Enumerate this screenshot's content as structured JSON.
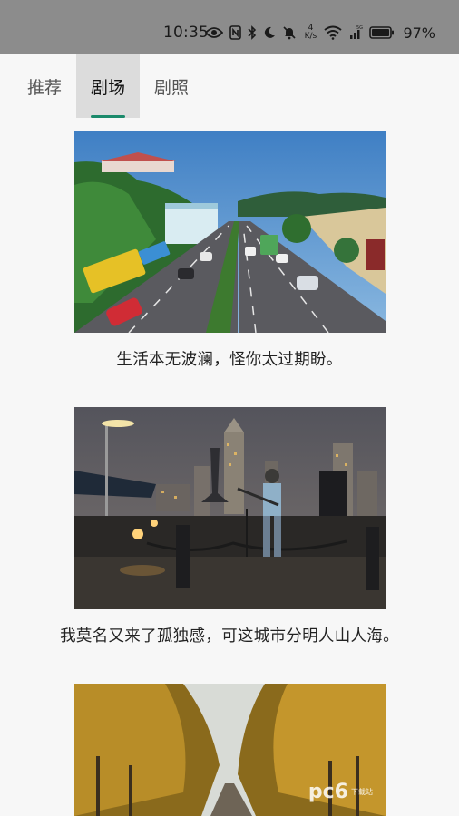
{
  "status_bar": {
    "time": "10:35",
    "net_speed_value": "4",
    "net_speed_unit": "K/s",
    "signal_label": "5G",
    "battery": "97%"
  },
  "tabs": [
    {
      "label": "推荐",
      "selected": false
    },
    {
      "label": "剧场",
      "selected": true
    },
    {
      "label": "剧照",
      "selected": false
    }
  ],
  "accent_color": "#1b8a6b",
  "feed": [
    {
      "caption": "生活本无波澜，怪你太过期盼。"
    },
    {
      "caption": "我莫名又来了孤独感，可这城市分明人山人海。"
    },
    {
      "caption": ""
    }
  ],
  "watermark": {
    "logo": "pc6",
    "sub": "下载站"
  }
}
